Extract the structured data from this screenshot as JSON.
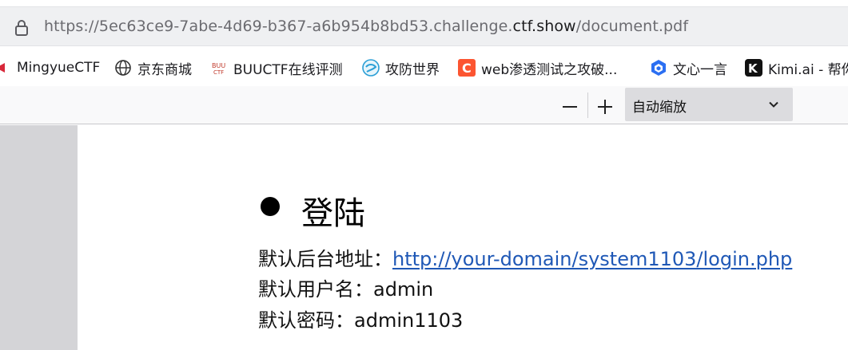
{
  "address_bar": {
    "url_prefix": "https://5ec63ce9-7abe-4d69-b367-a6b954b8bd53.challenge.",
    "url_domain": "ctf.show",
    "url_path": "/document.pdf"
  },
  "bookmarks": [
    {
      "label": "MingyueCTF",
      "icon": "mingyue-icon"
    },
    {
      "label": "京东商城",
      "icon": "globe-icon"
    },
    {
      "label": "BUUCTF在线评测",
      "icon": "buuctf-icon"
    },
    {
      "label": "攻防世界",
      "icon": "adworld-icon"
    },
    {
      "label": "web渗透测试之攻破...",
      "icon": "csdn-icon"
    },
    {
      "label": "文心一言",
      "icon": "wenxin-icon"
    },
    {
      "label": "Kimi.ai - 帮你",
      "icon": "kimi-icon"
    }
  ],
  "pdf_toolbar": {
    "zoom_label": "自动缩放"
  },
  "document": {
    "heading": "登陆",
    "admin_url_label": "默认后台地址：",
    "admin_url": "http://your-domain/system1103/login.php",
    "username_label": "默认用户名：",
    "username": "admin",
    "password_label": "默认密码：",
    "password": "admin1103"
  },
  "colors": {
    "link": "#1f58b6",
    "viewer_bg": "#d4d4d7",
    "urlbar_bg": "#eff0f2"
  }
}
